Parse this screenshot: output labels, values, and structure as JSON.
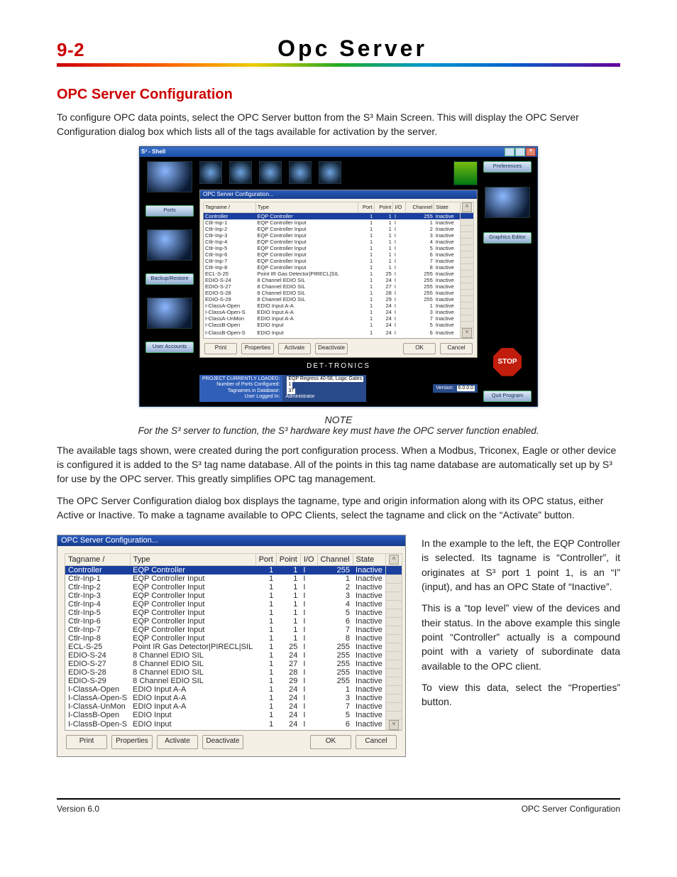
{
  "page": {
    "number": "9-2",
    "title": "Opc Server",
    "section_heading": "OPC Server Configuration",
    "intro": "To configure OPC data points, select the OPC Server button from the S³ Main Screen.  This will display the OPC Server Configuration dialog box which lists all of the tags available for activation by the server.",
    "note_label": "NOTE",
    "note": "For the S³ server to function, the S³ hardware key must have the OPC server function enabled.",
    "para2": "The available tags shown, were created during the port configuration process.  When a Modbus, Triconex, Eagle or other device is configured it is added to the S³ tag name database.  All of the points in this tag name database are automatically set up by S³ for use by the OPC server. This greatly simplifies OPC tag management.",
    "para3": "The OPC Server Configuration dialog box displays the tagname, type and origin information along with its OPC status, either Active or Inactive.  To make a tagname available to OPC Clients, select the tagname and click on the “Activate” button.",
    "para4": "In the example to the left, the EQP Controller is selected.  Its tagname is “Controller”, it originates at S³ port 1 point 1, is an “I” (input), and has an OPC State of “Inactive”.",
    "para5": "This is a “top level” view of the devices and their status.  In the above example this single point “Controller” actually is a compound point with a variety of subordinate data available to the OPC client.",
    "para6": "To view this data, select the “Properties” button.",
    "footer_version": "Version 6.0",
    "footer_section": "OPC Server Configuration"
  },
  "app_shell": {
    "title": "S³ - Shell",
    "rail": {
      "ports": "Ports",
      "backup": "Backup/Restore",
      "user_accounts": "User Accounts",
      "preferences": "Preferences",
      "graphics": "Graphics Editor",
      "quit": "Quit Program"
    },
    "stop": "STOP",
    "brand": "DET-TRONICS",
    "status": {
      "l1": "PROJECT CURRENTLY LOADED:",
      "r1": "EQP Regress 40-58, Logic Gates",
      "l2": "Number of Ports Configured:",
      "r2": "1",
      "l3": "Tagnames in Database:",
      "r3": "37",
      "l4": "User Logged In:",
      "r4": "Administrator",
      "ver_l": "Version:",
      "ver_v": "6.0.0.0"
    }
  },
  "opc_dialog": {
    "title": "OPC Server Configuration...",
    "headers": {
      "tag": "Tagname",
      "type": "Type",
      "port": "Port",
      "point": "Point",
      "io": "I/O",
      "channel": "Channel",
      "state": "State"
    },
    "sort_indicator": "/",
    "buttons": {
      "print": "Print",
      "properties": "Properties",
      "activate": "Activate",
      "deactivate": "Deactivate",
      "ok": "OK",
      "cancel": "Cancel"
    },
    "rows": [
      {
        "tag": "Controller",
        "type": "EQP Controller",
        "port": "1",
        "point": "1",
        "io": "I",
        "channel": "255",
        "state": "Inactive",
        "sel": true
      },
      {
        "tag": "Ctlr-Inp-1",
        "type": "EQP Controller Input",
        "port": "1",
        "point": "1",
        "io": "I",
        "channel": "1",
        "state": "Inactive"
      },
      {
        "tag": "Ctlr-Inp-2",
        "type": "EQP Controller Input",
        "port": "1",
        "point": "1",
        "io": "I",
        "channel": "2",
        "state": "Inactive"
      },
      {
        "tag": "Ctlr-Inp-3",
        "type": "EQP Controller Input",
        "port": "1",
        "point": "1",
        "io": "I",
        "channel": "3",
        "state": "Inactive"
      },
      {
        "tag": "Ctlr-Inp-4",
        "type": "EQP Controller Input",
        "port": "1",
        "point": "1",
        "io": "I",
        "channel": "4",
        "state": "Inactive"
      },
      {
        "tag": "Ctlr-Inp-5",
        "type": "EQP Controller Input",
        "port": "1",
        "point": "1",
        "io": "I",
        "channel": "5",
        "state": "Inactive"
      },
      {
        "tag": "Ctlr-Inp-6",
        "type": "EQP Controller Input",
        "port": "1",
        "point": "1",
        "io": "I",
        "channel": "6",
        "state": "Inactive"
      },
      {
        "tag": "Ctlr-Inp-7",
        "type": "EQP Controller Input",
        "port": "1",
        "point": "1",
        "io": "I",
        "channel": "7",
        "state": "Inactive"
      },
      {
        "tag": "Ctlr-Inp-8",
        "type": "EQP Controller Input",
        "port": "1",
        "point": "1",
        "io": "I",
        "channel": "8",
        "state": "Inactive"
      },
      {
        "tag": "ECL-S-25",
        "type": "Point IR Gas Detector|PIRECL|SIL",
        "port": "1",
        "point": "25",
        "io": "I",
        "channel": "255",
        "state": "Inactive"
      },
      {
        "tag": "EDIO-S-24",
        "type": "8 Channel EDIO SIL",
        "port": "1",
        "point": "24",
        "io": "I",
        "channel": "255",
        "state": "Inactive"
      },
      {
        "tag": "EDIO-S-27",
        "type": "8 Channel EDIO SIL",
        "port": "1",
        "point": "27",
        "io": "I",
        "channel": "255",
        "state": "Inactive"
      },
      {
        "tag": "EDIO-S-28",
        "type": "8 Channel EDIO SIL",
        "port": "1",
        "point": "28",
        "io": "I",
        "channel": "255",
        "state": "Inactive"
      },
      {
        "tag": "EDIO-S-29",
        "type": "8 Channel EDIO SIL",
        "port": "1",
        "point": "29",
        "io": "I",
        "channel": "255",
        "state": "Inactive"
      },
      {
        "tag": "I-ClassA-Open",
        "type": "EDIO Input A-A",
        "port": "1",
        "point": "24",
        "io": "I",
        "channel": "1",
        "state": "Inactive"
      },
      {
        "tag": "I-ClassA-Open-S",
        "type": "EDIO Input A-A",
        "port": "1",
        "point": "24",
        "io": "I",
        "channel": "3",
        "state": "Inactive"
      },
      {
        "tag": "I-ClassA-UnMon",
        "type": "EDIO Input A-A",
        "port": "1",
        "point": "24",
        "io": "I",
        "channel": "7",
        "state": "Inactive"
      },
      {
        "tag": "I-ClassB-Open",
        "type": "EDIO Input",
        "port": "1",
        "point": "24",
        "io": "I",
        "channel": "5",
        "state": "Inactive"
      },
      {
        "tag": "I-ClassB-Open-S",
        "type": "EDIO Input",
        "port": "1",
        "point": "24",
        "io": "I",
        "channel": "6",
        "state": "Inactive"
      }
    ]
  }
}
